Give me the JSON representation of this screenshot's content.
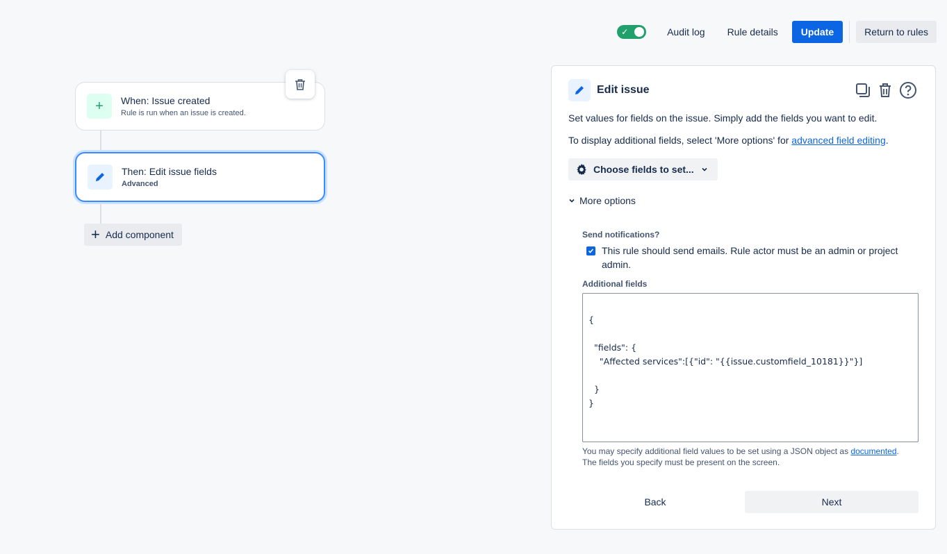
{
  "topbar": {
    "toggle_on": true,
    "audit_log": "Audit log",
    "rule_details": "Rule details",
    "update": "Update",
    "return_to_rules": "Return to rules"
  },
  "flow": {
    "trigger": {
      "title": "When: Issue created",
      "subtitle": "Rule is run when an issue is created."
    },
    "action": {
      "title": "Then: Edit issue fields",
      "subtitle": "Advanced"
    },
    "add_component": "Add component"
  },
  "panel": {
    "title": "Edit issue",
    "description": "Set values for fields on the issue. Simply add the fields you want to edit.",
    "more_info_prefix": "To display additional fields, select 'More options' for ",
    "more_info_link": "advanced field editing",
    "more_info_suffix": ".",
    "choose_fields": "Choose fields to set...",
    "more_options": "More options",
    "send_notifications_label": "Send notifications?",
    "send_notifications_checked": true,
    "send_notifications_text": "This rule should send emails. Rule actor must be an admin or project admin.",
    "additional_fields_label": "Additional fields",
    "additional_fields_value": "{\n\n  \"fields\": {\n    \"Affected services\":[{\"id\": \"{{issue.customfield_10181}}\"}]\n\n  }\n}",
    "helper_prefix": "You may specify additional field values to be set using a JSON object as ",
    "helper_link": "documented",
    "helper_suffix": ".",
    "helper_line2": "The fields you specify must be present on the screen.",
    "back": "Back",
    "next": "Next"
  },
  "colors": {
    "primary": "#0c66e4",
    "success": "#22a06b",
    "selected_border": "#388bff"
  }
}
